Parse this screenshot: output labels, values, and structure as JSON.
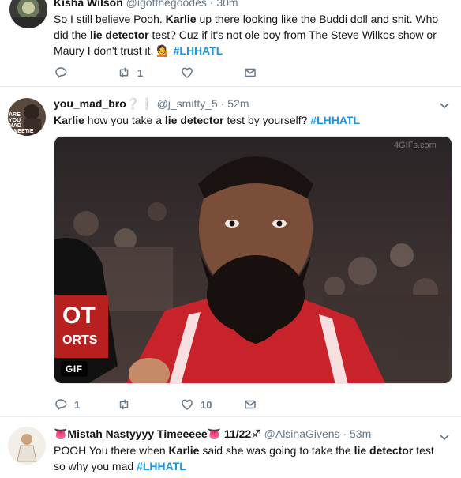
{
  "tweets": [
    {
      "name": "Kisha Wilson",
      "handle": "@igotthegoodes",
      "time": "30m",
      "text_parts": [
        "So I still believe Pooh. ",
        "Karlie",
        " up there looking like the Buddi doll and shit. Who did the ",
        "lie detector",
        " test? Cuz if it's not ole boy from The Steve Wilkos show or Maury I don't trust it. ",
        "💁",
        " ",
        "#LHHATL"
      ],
      "actions": {
        "reply": "",
        "retweet": "1",
        "like": ""
      }
    },
    {
      "name": "you_mad_bro",
      "name_emoji": "❔❕",
      "handle": "@j_smitty_5",
      "time": "52m",
      "text_parts": [
        "Karlie",
        " how you take a ",
        "lie detector",
        " test by yourself? ",
        "#LHHATL"
      ],
      "avatar_text": "ARE YOU MAD SWEETIE",
      "media": {
        "badge": "GIF",
        "watermark": "4GIFs.com",
        "jersey_text": "OT",
        "jersey_text2": "ORTS"
      },
      "actions": {
        "reply": "1",
        "retweet": "",
        "like": "10"
      }
    },
    {
      "name": "👅Mistah Nastyyyy Timeeeee👅 11/22♐",
      "handle": "@AlsinaGivens",
      "time": "53m",
      "text_parts": [
        "POOH You there when ",
        "Karlie",
        " said she was going to take the ",
        "lie detector",
        " test so why you mad ",
        "#LHHATL"
      ]
    }
  ],
  "colors": {
    "hashtag": "#1b95e0",
    "meta": "#657786",
    "text": "#14171a"
  },
  "icons": [
    "reply-icon",
    "retweet-icon",
    "like-icon",
    "dm-icon",
    "caret-down-icon"
  ]
}
